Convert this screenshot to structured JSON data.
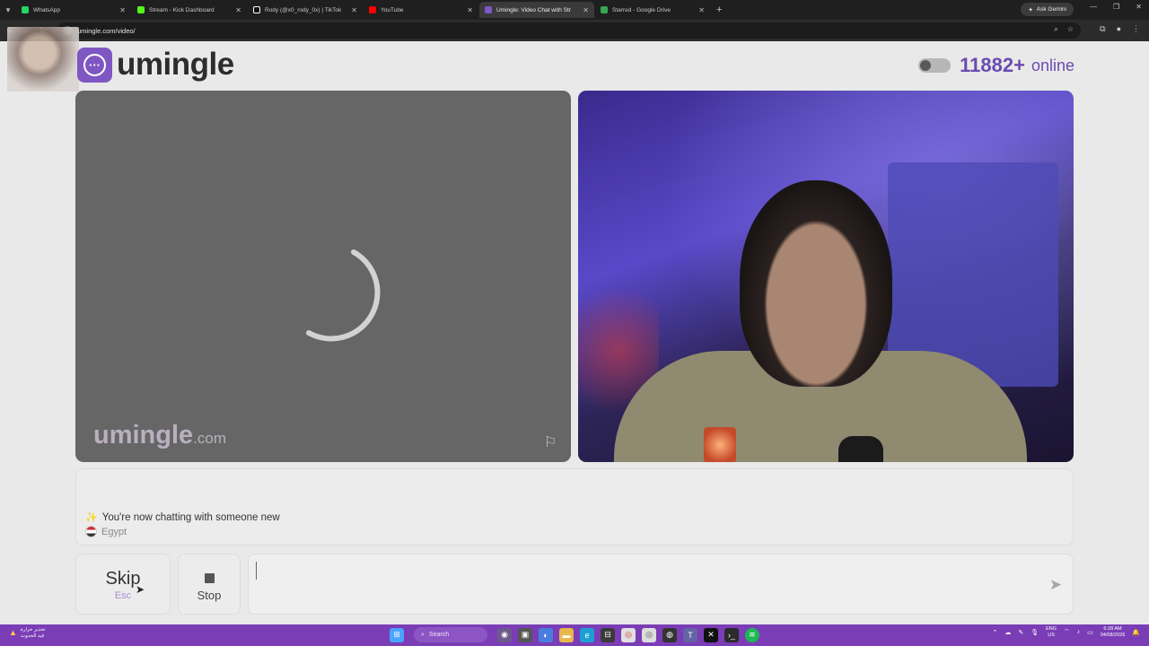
{
  "browser": {
    "tabs": [
      {
        "label": "WhatsApp",
        "color": "#25d366",
        "active": false
      },
      {
        "label": "Stream - Kick Dashboard",
        "color": "#53fc18",
        "active": false
      },
      {
        "label": "Rody (@x0_rody_0x) | TikTok",
        "color": "#ffffff",
        "active": false
      },
      {
        "label": "YouTube",
        "color": "#ff0000",
        "active": false
      },
      {
        "label": "Umingle: Video Chat with Str",
        "color": "#7e57c2",
        "active": true
      },
      {
        "label": "Starred - Google Drive",
        "color": "#34a853",
        "active": false
      }
    ],
    "new_tab": "+",
    "gemini_label": "Ask Gemini",
    "url": "umingle.com/video/"
  },
  "header": {
    "logo_text": "umingle",
    "online_count": "11882+",
    "online_label": "online",
    "accent_color": "#6a4bb0"
  },
  "video": {
    "watermark_main": "umingle",
    "watermark_domain": ".com"
  },
  "chat": {
    "system_message": "You're now chatting with someone new",
    "country": "Egypt"
  },
  "controls": {
    "skip_label": "Skip",
    "skip_key": "Esc",
    "stop_label": "Stop",
    "message_placeholder": ""
  },
  "taskbar": {
    "weather_line1": "تحذير حرارة",
    "weather_line2": "قيد الحدوث",
    "search_label": "Search",
    "lang_line1": "ENG",
    "lang_line2": "US",
    "time": "6:28 AM",
    "date": "04/08/2026"
  }
}
